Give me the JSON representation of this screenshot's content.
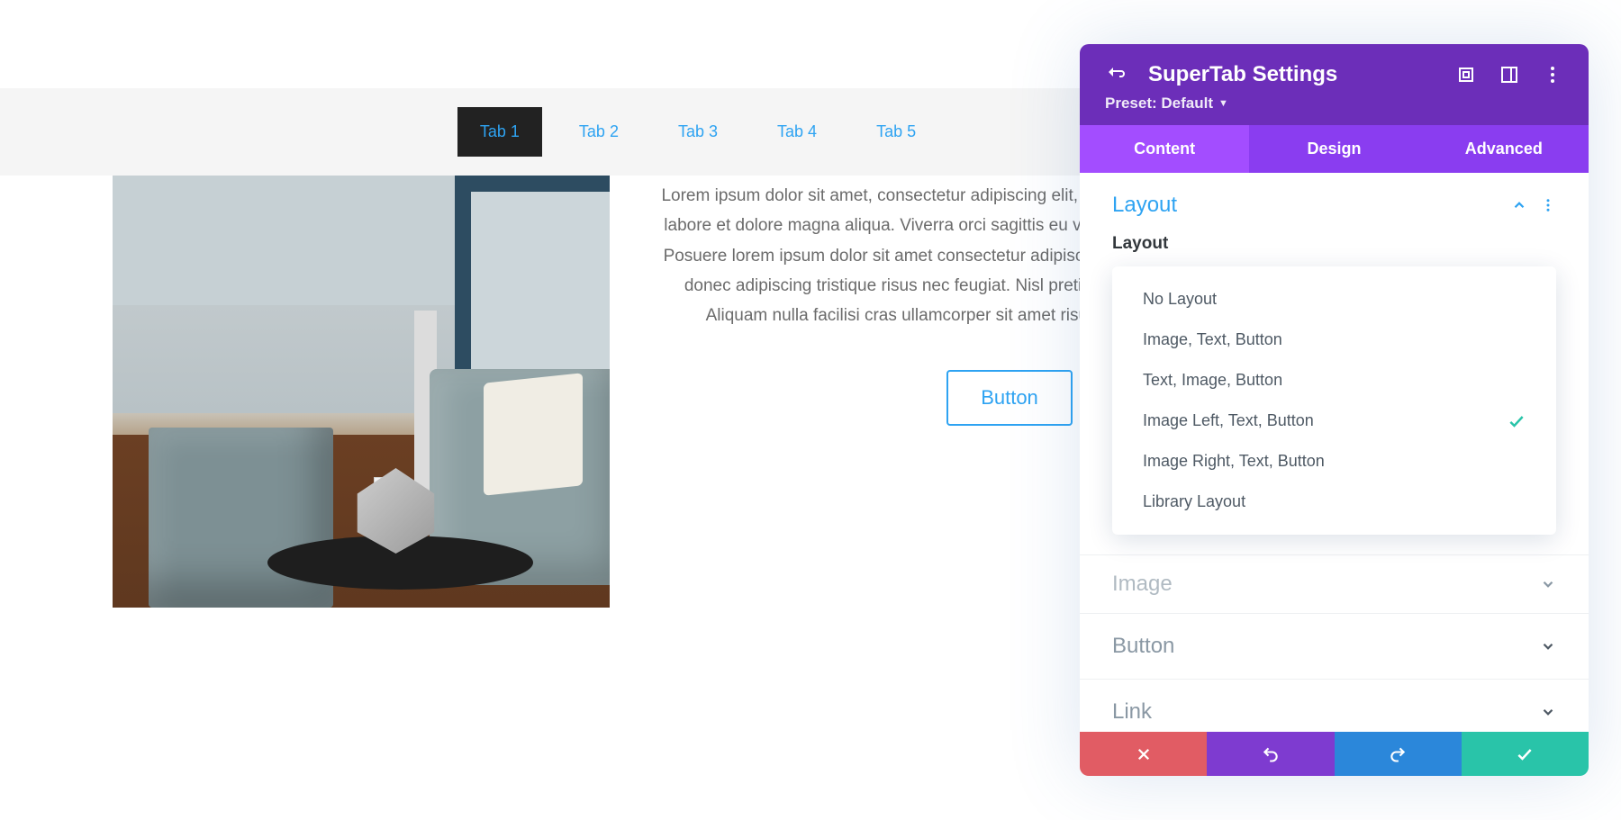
{
  "tabs": {
    "items": [
      "Tab 1",
      "Tab 2",
      "Tab 3",
      "Tab 4",
      "Tab 5"
    ],
    "activeIndex": 0
  },
  "content": {
    "paragraph": "Lorem ipsum dolor sit amet, consectetur adipiscing elit, sed do eiusmod tempor incididunt ut labore et dolore magna aliqua. Viverra orci sagittis eu volutpat odio facilisis mauris sit amet. Posuere lorem ipsum dolor sit amet consectetur adipiscing elit. Aenean sed adipiscing diam donec adipiscing tristique risus nec feugiat. Nisl pretium fusce id velit ut tortor pretium. Aliquam nulla facilisi cras ullamcorper sit amet risus nullam eget. Eleifend quam.",
    "button_label": "Button"
  },
  "panel": {
    "title": "SuperTab Settings",
    "preset_label": "Preset: Default",
    "tabs": [
      "Content",
      "Design",
      "Advanced"
    ],
    "activeTab": 0,
    "sections": {
      "layout": {
        "title": "Layout",
        "field_label": "Layout",
        "options": [
          "No Layout",
          "Image, Text, Button",
          "Text, Image, Button",
          "Image Left, Text, Button",
          "Image Right, Text, Button",
          "Library Layout"
        ],
        "selectedIndex": 3
      },
      "image_title": "Image",
      "button_title": "Button",
      "link_title": "Link"
    }
  }
}
